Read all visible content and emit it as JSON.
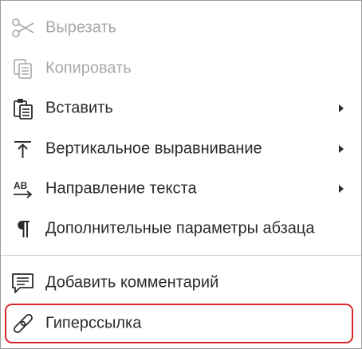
{
  "menu": {
    "items": [
      {
        "id": "cut",
        "label": "Вырезать",
        "icon": "scissors-icon",
        "enabled": false,
        "submenu": false
      },
      {
        "id": "copy",
        "label": "Копировать",
        "icon": "copy-icon",
        "enabled": false,
        "submenu": false
      },
      {
        "id": "paste",
        "label": "Вставить",
        "icon": "paste-icon",
        "enabled": true,
        "submenu": true
      },
      {
        "id": "valign",
        "label": "Вертикальное выравнивание",
        "icon": "vertical-align-icon",
        "enabled": true,
        "submenu": true
      },
      {
        "id": "text-direction",
        "label": "Направление текста",
        "icon": "text-direction-icon",
        "enabled": true,
        "submenu": true
      },
      {
        "id": "paragraph",
        "label": "Дополнительные параметры абзаца",
        "icon": "paragraph-icon",
        "enabled": true,
        "submenu": false
      },
      {
        "id": "comment",
        "label": "Добавить комментарий",
        "icon": "comment-icon",
        "enabled": true,
        "submenu": false
      },
      {
        "id": "hyperlink",
        "label": "Гиперссылка",
        "icon": "link-icon",
        "enabled": true,
        "submenu": false,
        "highlighted": true
      }
    ],
    "text_direction_icon_text": "AB",
    "colors": {
      "text": "#2b2b2b",
      "disabled_text": "#a8a8a8",
      "highlight_border": "#d9262c",
      "divider": "#d2d2d2"
    }
  }
}
